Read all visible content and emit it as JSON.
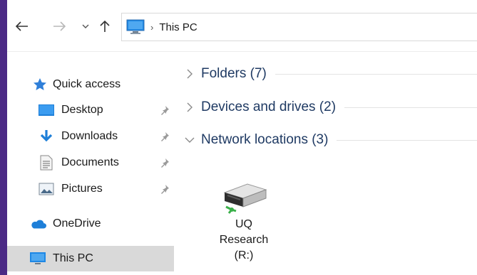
{
  "address": {
    "path": "This PC"
  },
  "sidebar": {
    "items": [
      {
        "label": "Quick access",
        "icon": "star-icon"
      },
      {
        "label": "Desktop",
        "icon": "desktop-folder-icon",
        "pinned": true
      },
      {
        "label": "Downloads",
        "icon": "download-arrow-icon",
        "pinned": true
      },
      {
        "label": "Documents",
        "icon": "document-icon",
        "pinned": true
      },
      {
        "label": "Pictures",
        "icon": "pictures-icon",
        "pinned": true
      },
      {
        "label": "OneDrive",
        "icon": "cloud-icon"
      },
      {
        "label": "This PC",
        "icon": "computer-icon",
        "selected": true
      }
    ]
  },
  "main": {
    "groups": [
      {
        "label": "Folders (7)",
        "expanded": false
      },
      {
        "label": "Devices and drives (2)",
        "expanded": false
      },
      {
        "label": "Network locations (3)",
        "expanded": true
      }
    ],
    "network_items": [
      {
        "line1": "UQ",
        "line2": "Research",
        "line3": "(R:)",
        "icon": "network-drive-icon"
      }
    ]
  },
  "colors": {
    "background": "#4b2a85",
    "group_text": "#1f3a63",
    "selected": "#d9d9d9",
    "accent_blue": "#1e88e5"
  }
}
